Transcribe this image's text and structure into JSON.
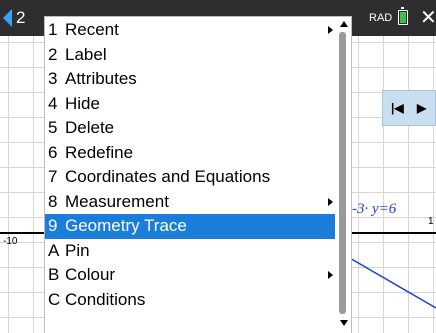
{
  "titlebar": {
    "tab_number": "2",
    "angle_mode": "RAD",
    "close_glyph": "✕",
    "accent": "#3aa2ff",
    "battery_color": "#3ec14a"
  },
  "graph": {
    "x_tick_left": "-10",
    "x_tick_right": "1",
    "equation_label": "-3· y=6",
    "line_color": "#1f40d9",
    "play_controls": [
      "|◀",
      "▶"
    ]
  },
  "menu": {
    "items": [
      {
        "key": "1",
        "label": "Recent",
        "submenu": true
      },
      {
        "key": "2",
        "label": "Label"
      },
      {
        "key": "3",
        "label": "Attributes"
      },
      {
        "key": "4",
        "label": "Hide"
      },
      {
        "key": "5",
        "label": "Delete"
      },
      {
        "key": "6",
        "label": "Redefine"
      },
      {
        "key": "7",
        "label": "Coordinates and Equations"
      },
      {
        "key": "8",
        "label": "Measurement",
        "submenu": true
      },
      {
        "key": "9",
        "label": "Geometry Trace",
        "selected": true
      },
      {
        "key": "A",
        "label": "Pin"
      },
      {
        "key": "B",
        "label": "Colour",
        "submenu": true
      },
      {
        "key": "C",
        "label": "Conditions"
      }
    ],
    "selected_color": "#1a7ddc"
  }
}
